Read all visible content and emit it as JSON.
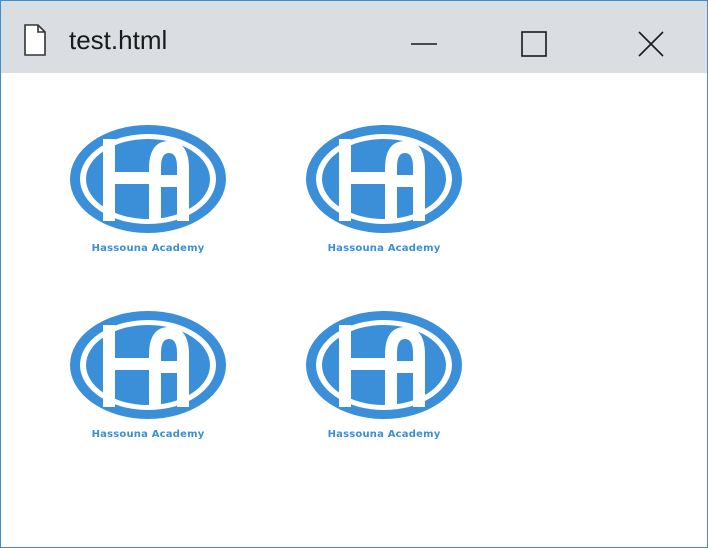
{
  "window": {
    "title": "test.html",
    "accent_border": "#3c8fd6",
    "titlebar_bg": "#dadee3"
  },
  "controls": {
    "minimize_icon": "minimize-icon",
    "maximize_icon": "maximize-icon",
    "close_icon": "close-icon"
  },
  "logos": [
    {
      "caption": "Hassouna Academy"
    },
    {
      "caption": "Hassouna Academy"
    },
    {
      "caption": "Hassouna Academy"
    },
    {
      "caption": "Hassouna Academy"
    }
  ],
  "brand_color": "#3b8fd8"
}
